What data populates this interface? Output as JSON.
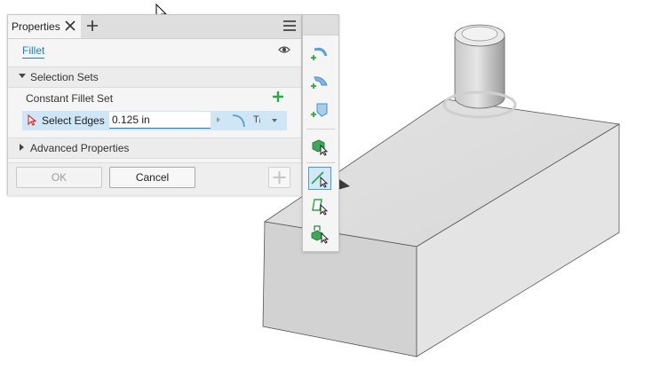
{
  "panel": {
    "tab_label": "Properties",
    "feature_name": "Fillet",
    "sections": {
      "selection_sets": "Selection Sets",
      "advanced": "Advanced Properties"
    },
    "set_label": "Constant Fillet Set",
    "edges_label": "Select Edges",
    "radius_value": "0.125 in",
    "type_label": "Tᵢ",
    "buttons": {
      "ok": "OK",
      "cancel": "Cancel"
    }
  },
  "mini_toolbar": {
    "tools": [
      {
        "name": "add-fillet-icon",
        "selected": false
      },
      {
        "name": "add-variable-fillet-icon",
        "selected": false
      },
      {
        "name": "add-setback-icon",
        "selected": false
      },
      {
        "name": "select-solid-icon",
        "selected": false
      },
      {
        "name": "select-edge-icon",
        "selected": true
      },
      {
        "name": "select-face-icon",
        "selected": false
      },
      {
        "name": "select-feature-icon",
        "selected": false
      }
    ]
  },
  "colors": {
    "accent": "#1a7fd0",
    "highlight_row": "#cfe6f7",
    "green_plus": "#2aa84a",
    "model_face": "#dcdcdc"
  }
}
